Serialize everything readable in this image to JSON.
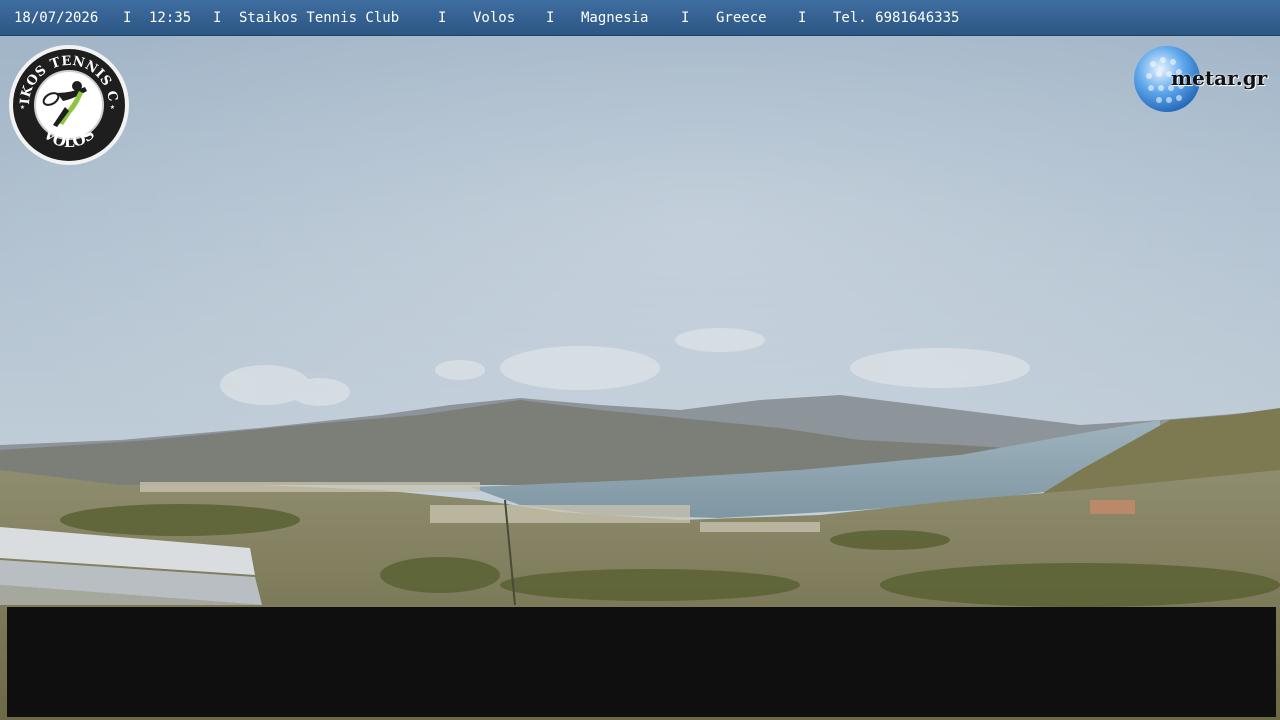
{
  "overlay": {
    "date": "18/07/2026",
    "time": "12:35",
    "club": "Staikos Tennis Club",
    "city": "Volos",
    "region": "Magnesia",
    "country": "Greece",
    "phone": "Tel. 6981646335",
    "separator": "I"
  },
  "logo_left": {
    "top_text": "STAIKOS TENNIS CLUB",
    "bottom_text": "VOLOS",
    "icon": "tennis-player-icon"
  },
  "logo_right": {
    "text": "metar.gr",
    "icon": "golf-ball-globe-icon"
  },
  "colors": {
    "bar": "#3a6898",
    "sky": "#b3c3d1",
    "sea": "#8aa3b3",
    "black_panel": "#0f0f0f"
  }
}
